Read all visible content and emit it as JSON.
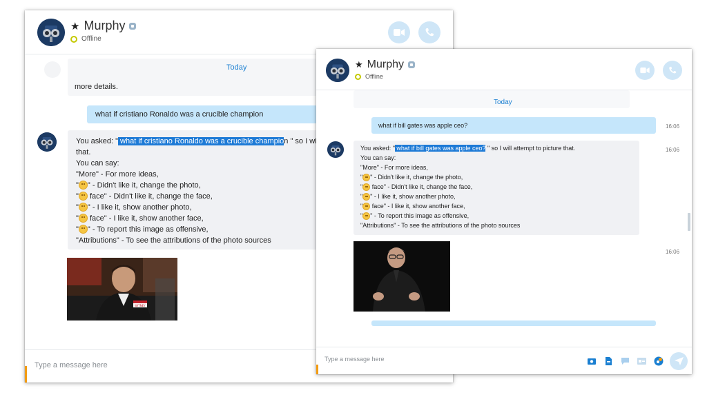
{
  "window_back": {
    "contact_name": "Murphy",
    "status": "Offline",
    "date_divider": "Today",
    "prev_message_tail": "more details.",
    "sent_message": "what if cristiano Ronaldo was a crucible champion",
    "reply": {
      "prefix": "You asked: \"",
      "query": " what if cristiano Ronaldo was a crucible champio",
      "suffix": "n \" so I will a",
      "line2": "that.",
      "can_say": " You can say:",
      "options": [
        "\"More\" - For more ideas,",
        "\" - Didn't like it, change the photo,",
        "face\" - Didn't like it, change the face,",
        "\" - I like it, show another photo,",
        "face\" - I like it, show another face,",
        "\" - To report this image as offensive,",
        "\"Attributions\" - To see the attributions of the photo sources"
      ]
    },
    "photo_badge": "WITNEY",
    "input_placeholder": "Type a message here"
  },
  "window_front": {
    "contact_name": "Murphy",
    "status": "Offline",
    "date_divider": "Today",
    "sent_message": "what if bill gates was apple ceo?",
    "sent_time": "16:06",
    "reply_time": "16:06",
    "photo_time": "16:06",
    "reply": {
      "prefix": "You asked: \"",
      "query": " what if bill gates was apple ceo?",
      "suffix": " \" so I will attempt to picture that.",
      "can_say": " You can say:",
      "options": [
        "\"More\" - For more ideas,",
        "\" - Didn't like it, change the photo,",
        "face\" - Didn't like it, change the face,",
        "\" - I like it, show another photo,",
        "face\" - I like it, show another face,",
        "\" - To report this image as offensive,",
        "\"Attributions\" - To see the attributions of the photo sources"
      ]
    },
    "input_placeholder": "Type a message here"
  },
  "colors": {
    "accent_blue": "#1d7ad6",
    "outgoing_bubble": "#c5e6fb",
    "incoming_bubble": "#f0f1f4",
    "call_button": "#cfe6f7",
    "input_accent": "#f39c12"
  },
  "icons": [
    "star-icon",
    "verified-icon",
    "video-call-icon",
    "audio-call-icon",
    "media-icon",
    "file-icon",
    "emoticon-icon",
    "contact-card-icon",
    "bot-icon",
    "send-icon"
  ]
}
